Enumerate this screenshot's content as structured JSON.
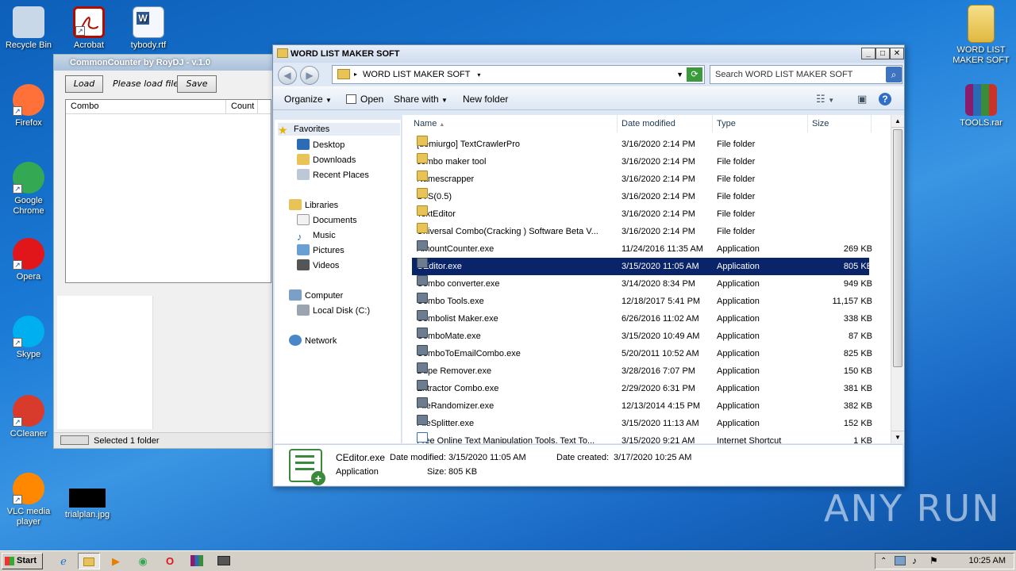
{
  "desktop": {
    "icons_left": [
      {
        "label": "Recycle Bin",
        "icon": "recycle-bin-icon",
        "color": "#c8d8e8"
      },
      {
        "label": "Firefox",
        "icon": "firefox-icon",
        "color": "#ff7139"
      },
      {
        "label": "Google Chrome",
        "icon": "chrome-icon",
        "color": "#34a853"
      },
      {
        "label": "Opera",
        "icon": "opera-icon",
        "color": "#e0161b"
      },
      {
        "label": "Skype",
        "icon": "skype-icon",
        "color": "#00aff0"
      },
      {
        "label": "CCleaner",
        "icon": "ccleaner-icon",
        "color": "#d83b2b"
      },
      {
        "label": "VLC media player",
        "icon": "vlc-icon",
        "color": "#ff8800"
      }
    ],
    "icons_top": [
      {
        "label": "Acrobat",
        "icon": "acrobat-icon"
      },
      {
        "label": "tybody.rtf",
        "icon": "word-document-icon"
      }
    ],
    "icon_trialplan": {
      "label": "trialplan.jpg",
      "icon": "image-file-icon"
    },
    "icons_right": [
      {
        "label": "WORD LIST MAKER SOFT",
        "icon": "zip-folder-icon"
      },
      {
        "label": "TOOLS.rar",
        "icon": "winrar-icon"
      }
    ],
    "watermark": "ANY RUN"
  },
  "common_counter": {
    "title": "CommonCounter by RoyDJ - v.1.0",
    "load_label": "Load",
    "status_text": "Please load file",
    "save_label": "Save",
    "columns": [
      "Combo",
      "Count"
    ],
    "statusbar": "Selected 1 folder"
  },
  "explorer": {
    "title": "WORD LIST MAKER SOFT",
    "address": "WORD LIST MAKER SOFT",
    "search_placeholder": "Search WORD LIST MAKER SOFT",
    "toolbar": {
      "organize": "Organize",
      "open": "Open",
      "share_with": "Share with",
      "new_folder": "New folder"
    },
    "nav": {
      "favorites": "Favorites",
      "desktop": "Desktop",
      "downloads": "Downloads",
      "recent_places": "Recent Places",
      "libraries": "Libraries",
      "documents": "Documents",
      "music": "Music",
      "pictures": "Pictures",
      "videos": "Videos",
      "computer": "Computer",
      "local_disk": "Local Disk (C:)",
      "network": "Network"
    },
    "columns": {
      "name": "Name",
      "date": "Date modified",
      "type": "Type",
      "size": "Size"
    },
    "files": [
      {
        "name": "[demiurgo] TextCrawlerPro",
        "date": "3/16/2020 2:14 PM",
        "type": "File folder",
        "size": "",
        "kind": "folder"
      },
      {
        "name": "combo maker tool",
        "date": "3/16/2020 2:14 PM",
        "type": "File folder",
        "size": "",
        "kind": "folder"
      },
      {
        "name": "Namescrapper",
        "date": "3/16/2020 2:14 PM",
        "type": "File folder",
        "size": "",
        "kind": "folder"
      },
      {
        "name": "STS(0.5)",
        "date": "3/16/2020 2:14 PM",
        "type": "File folder",
        "size": "",
        "kind": "folder"
      },
      {
        "name": "TextEditor",
        "date": "3/16/2020 2:14 PM",
        "type": "File folder",
        "size": "",
        "kind": "folder"
      },
      {
        "name": "Universal Combo(Cracking ) Software Beta V...",
        "date": "3/16/2020 2:14 PM",
        "type": "File folder",
        "size": "",
        "kind": "folder"
      },
      {
        "name": "AmountCounter.exe",
        "date": "11/24/2016 11:35 AM",
        "type": "Application",
        "size": "269 KB",
        "kind": "app"
      },
      {
        "name": "CEditor.exe",
        "date": "3/15/2020 11:05 AM",
        "type": "Application",
        "size": "805 KB",
        "kind": "app",
        "selected": true
      },
      {
        "name": "Combo converter.exe",
        "date": "3/14/2020 8:34 PM",
        "type": "Application",
        "size": "949 KB",
        "kind": "app"
      },
      {
        "name": "Combo Tools.exe",
        "date": "12/18/2017 5:41 PM",
        "type": "Application",
        "size": "11,157 KB",
        "kind": "app"
      },
      {
        "name": "Combolist Maker.exe",
        "date": "6/26/2016 11:02 AM",
        "type": "Application",
        "size": "338 KB",
        "kind": "app"
      },
      {
        "name": "ComboMate.exe",
        "date": "3/15/2020 10:49 AM",
        "type": "Application",
        "size": "87 KB",
        "kind": "app"
      },
      {
        "name": "ComboToEmailCombo.exe",
        "date": "5/20/2011 10:52 AM",
        "type": "Application",
        "size": "825 KB",
        "kind": "app"
      },
      {
        "name": "Dupe Remover.exe",
        "date": "3/28/2016 7:07 PM",
        "type": "Application",
        "size": "150 KB",
        "kind": "app"
      },
      {
        "name": "Extractor Combo.exe",
        "date": "2/29/2020 6:31 PM",
        "type": "Application",
        "size": "381 KB",
        "kind": "app"
      },
      {
        "name": "FileRandomizer.exe",
        "date": "12/13/2014 4:15 PM",
        "type": "Application",
        "size": "382 KB",
        "kind": "app"
      },
      {
        "name": "FileSplitter.exe",
        "date": "3/15/2020 11:13 AM",
        "type": "Application",
        "size": "152 KB",
        "kind": "app"
      },
      {
        "name": "Free Online Text Manipulation Tools, Text To...",
        "date": "3/15/2020 9:21 AM",
        "type": "Internet Shortcut",
        "size": "1 KB",
        "kind": "link"
      }
    ],
    "details": {
      "filename": "CEditor.exe",
      "date_modified_label": "Date modified:",
      "date_modified": "3/15/2020 11:05 AM",
      "date_created_label": "Date created:",
      "date_created": "3/17/2020 10:25 AM",
      "type": "Application",
      "size_label": "Size:",
      "size": "805 KB"
    }
  },
  "taskbar": {
    "start_label": "Start",
    "clock": "10:25 AM"
  }
}
